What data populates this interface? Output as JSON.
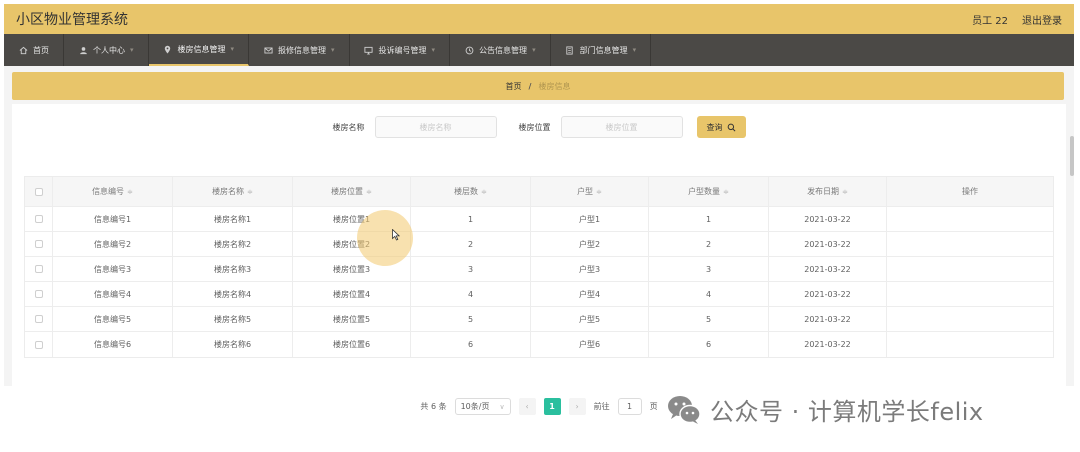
{
  "header": {
    "app_title": "小区物业管理系统",
    "user": "员工 22",
    "logout": "退出登录"
  },
  "nav": {
    "items": [
      {
        "label": "首页",
        "caret": ""
      },
      {
        "label": "个人中心",
        "caret": "▾"
      },
      {
        "label": "楼房信息管理",
        "caret": "▾"
      },
      {
        "label": "报修信息管理",
        "caret": "▾"
      },
      {
        "label": "投诉编号管理",
        "caret": "▾"
      },
      {
        "label": "公告信息管理",
        "caret": "▾"
      },
      {
        "label": "部门信息管理",
        "caret": "▾"
      }
    ]
  },
  "breadcrumb": {
    "home": "首页",
    "separator": "/",
    "current": "楼房信息"
  },
  "search": {
    "name_label": "楼房名称",
    "name_placeholder": "楼房名称",
    "location_label": "楼房位置",
    "location_placeholder": "楼房位置",
    "query_button": "查询"
  },
  "table": {
    "headers": [
      "信息编号",
      "楼房名称",
      "楼房位置",
      "楼层数",
      "户型",
      "户型数量",
      "发布日期",
      "操作"
    ],
    "sort_glyph": "≑",
    "rows": [
      [
        "信息编号1",
        "楼房名称1",
        "楼房位置1",
        "1",
        "户型1",
        "1",
        "2021-03-22"
      ],
      [
        "信息编号2",
        "楼房名称2",
        "楼房位置2",
        "2",
        "户型2",
        "2",
        "2021-03-22"
      ],
      [
        "信息编号3",
        "楼房名称3",
        "楼房位置3",
        "3",
        "户型3",
        "3",
        "2021-03-22"
      ],
      [
        "信息编号4",
        "楼房名称4",
        "楼房位置4",
        "4",
        "户型4",
        "4",
        "2021-03-22"
      ],
      [
        "信息编号5",
        "楼房名称5",
        "楼房位置5",
        "5",
        "户型5",
        "5",
        "2021-03-22"
      ],
      [
        "信息编号6",
        "楼房名称6",
        "楼房位置6",
        "6",
        "户型6",
        "6",
        "2021-03-22"
      ]
    ]
  },
  "pagination": {
    "total": "共 6 条",
    "page_size": "10条/页",
    "prev": "‹",
    "current_page": "1",
    "next": "›",
    "goto_label": "前往",
    "goto_value": "1",
    "goto_suffix": "页"
  },
  "watermark": {
    "text": "公众号 · 计算机学长felix"
  },
  "colors": {
    "header": "#e8c56a",
    "nav": "#4b4946",
    "active_page": "#2abf9e"
  }
}
